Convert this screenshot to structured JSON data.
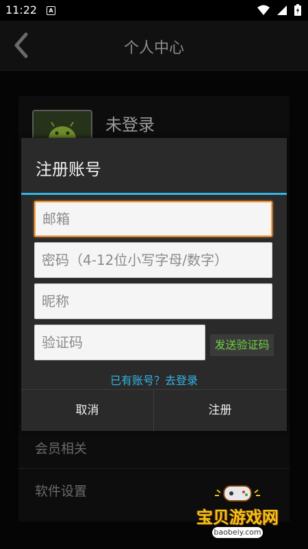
{
  "status_bar": {
    "time": "11:22",
    "notification_icon": "A"
  },
  "header": {
    "title": "个人中心"
  },
  "profile": {
    "name": "未登录"
  },
  "menu": {
    "items": [
      "会员相关",
      "软件设置"
    ]
  },
  "dialog": {
    "title": "注册账号",
    "email_placeholder": "邮箱",
    "password_placeholder": "密码（4-12位小写字母/数字）",
    "nickname_placeholder": "昵称",
    "code_placeholder": "验证码",
    "send_code_label": "发送验证码",
    "login_link": "已有账号？去登录",
    "cancel_label": "取消",
    "register_label": "注册"
  },
  "watermark": {
    "title": "宝贝游戏网",
    "url": "baobeiy.com"
  },
  "colors": {
    "accent": "#33b5e5",
    "focus": "#f4a040",
    "send_code_text": "#6fcf42",
    "watermark_yellow": "#f1c21a"
  }
}
